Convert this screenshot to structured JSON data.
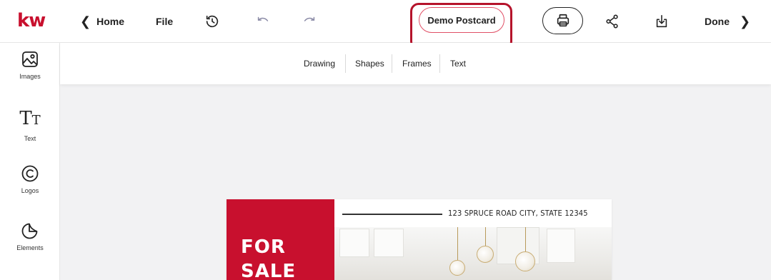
{
  "topbar": {
    "logo": "kw",
    "home_label": "Home",
    "file_label": "File",
    "document_title": "Demo Postcard",
    "done_label": "Done",
    "icons": [
      "history-icon",
      "undo-icon",
      "redo-icon",
      "print-icon",
      "share-icon",
      "download-icon"
    ]
  },
  "rail": {
    "items": [
      {
        "label": "Images",
        "icon": "image-icon"
      },
      {
        "label": "Text",
        "icon": "text-icon",
        "glyph": "TT"
      },
      {
        "label": "Logos",
        "icon": "copyright-icon"
      },
      {
        "label": "Elements",
        "icon": "elements-icon"
      }
    ]
  },
  "subbar": {
    "tabs": [
      "Drawing",
      "Shapes",
      "Frames",
      "Text"
    ]
  },
  "postcard": {
    "headline_line1": "FOR",
    "headline_line2": "SALE",
    "address": "123 SPRUCE ROAD CITY, STATE 12345"
  },
  "colors": {
    "brand_red": "#c8102e",
    "highlight_red": "#b5132b"
  }
}
